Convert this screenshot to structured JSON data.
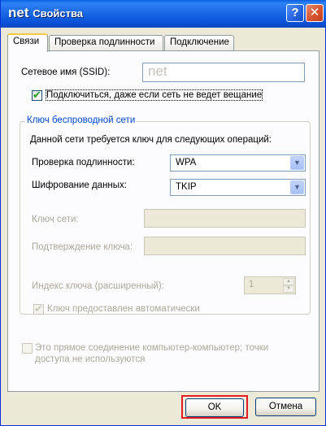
{
  "window": {
    "title_name": "net",
    "title_suffix": "Свойства",
    "help_glyph": "?",
    "close_glyph": "✕"
  },
  "tabs": [
    {
      "label": "Связи",
      "active": true
    },
    {
      "label": "Проверка подлинности",
      "active": false
    },
    {
      "label": "Подключение",
      "active": false
    }
  ],
  "ssid": {
    "label": "Сетевое имя (SSID):",
    "value": "net"
  },
  "broadcast_checkbox": {
    "label": "Подключиться, даже если сеть не ведет вещание",
    "checked": true
  },
  "key_group": {
    "title": "Ключ беспроводной сети",
    "description": "Данной сети требуется ключ для следующих операций:",
    "auth": {
      "label": "Проверка подлинности:",
      "value": "WPA"
    },
    "encryption": {
      "label": "Шифрование данных:",
      "value": "TKIP"
    },
    "network_key": {
      "label": "Ключ сети:",
      "value": ""
    },
    "confirm_key": {
      "label": "Подтверждение ключа:",
      "value": ""
    },
    "key_index": {
      "label": "Индекс ключа (расширенный):",
      "value": "1"
    },
    "auto_key": {
      "label": "Ключ предоставлен автоматически",
      "checked": true
    }
  },
  "adhoc_checkbox": {
    "label_line1": "Это прямое соединение компьютер-компьютер; точки",
    "label_line2": "доступа не используются",
    "checked": false
  },
  "buttons": {
    "ok": "OK",
    "cancel": "Отмена"
  },
  "icons": {
    "dropdown": "▼",
    "spin_up": "▲",
    "spin_down": "▼",
    "check": "✔"
  },
  "colors": {
    "titlebar": "#0a52d8",
    "face": "#ece9d8",
    "group_title": "#0046d5",
    "highlight": "#e31d24"
  }
}
